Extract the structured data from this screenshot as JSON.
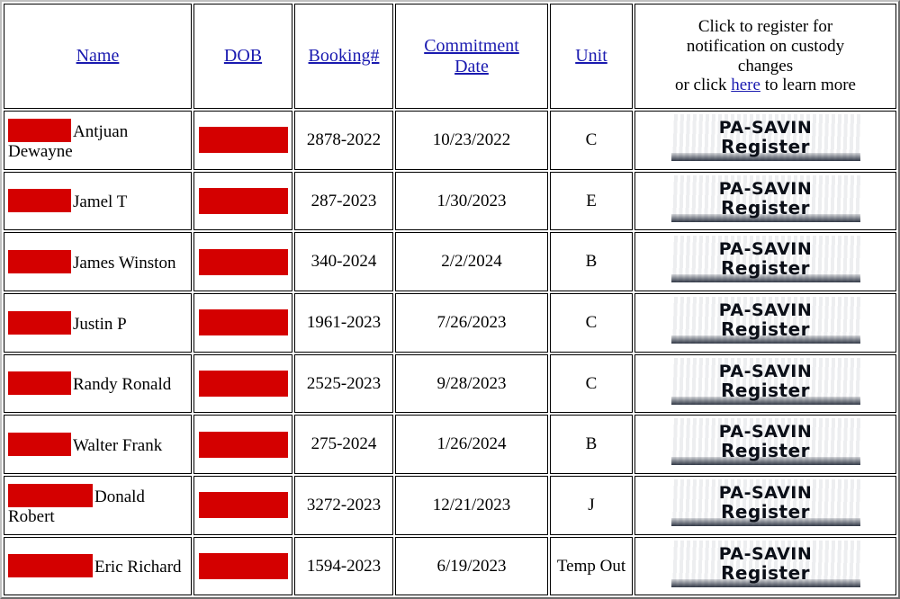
{
  "table": {
    "columns": [
      {
        "key": "name",
        "label": "Name",
        "link": true
      },
      {
        "key": "dob",
        "label": "DOB",
        "link": true
      },
      {
        "key": "book",
        "label": "Booking#",
        "link": true
      },
      {
        "key": "commit",
        "label": "Commitment Date",
        "link": true
      },
      {
        "key": "unit",
        "label": "Unit",
        "link": true
      },
      {
        "key": "savin",
        "label": "",
        "link": false
      }
    ],
    "header_links": {
      "name": "Name",
      "dob": "DOB",
      "booking": "Booking#",
      "commitment_line1": "Commitment",
      "commitment_line2": "Date",
      "unit": "Unit"
    },
    "savin_header": {
      "line1": "Click to register for",
      "line2": "notification on custody",
      "line3": "changes",
      "line4_prefix": "or click ",
      "line4_link": "here",
      "line4_suffix": " to learn more"
    },
    "savin_button": {
      "line1": "PA-SAVIN",
      "line2": "Register",
      "alt": "PA-SAVIN Register"
    },
    "redaction_color": "#d40000",
    "link_color": "#1a1ab0",
    "rows": [
      {
        "name_redacted": true,
        "name_redaction_width": "narrow",
        "name": "Antjuan Dewayne",
        "dob_redacted": true,
        "dob": "",
        "booking": "2878-2022",
        "commitment_date": "10/23/2022",
        "unit": "C"
      },
      {
        "name_redacted": true,
        "name_redaction_width": "narrow",
        "name": "Jamel T",
        "dob_redacted": true,
        "dob": "",
        "booking": "287-2023",
        "commitment_date": "1/30/2023",
        "unit": "E"
      },
      {
        "name_redacted": true,
        "name_redaction_width": "narrow",
        "name": "James Winston",
        "dob_redacted": true,
        "dob": "",
        "booking": "340-2024",
        "commitment_date": "2/2/2024",
        "unit": "B"
      },
      {
        "name_redacted": true,
        "name_redaction_width": "narrow",
        "name": "Justin P",
        "dob_redacted": true,
        "dob": "",
        "booking": "1961-2023",
        "commitment_date": "7/26/2023",
        "unit": "C"
      },
      {
        "name_redacted": true,
        "name_redaction_width": "narrow",
        "name": "Randy Ronald",
        "dob_redacted": true,
        "dob": "",
        "booking": "2525-2023",
        "commitment_date": "9/28/2023",
        "unit": "C"
      },
      {
        "name_redacted": true,
        "name_redaction_width": "narrow",
        "name": "Walter Frank",
        "dob_redacted": true,
        "dob": "",
        "booking": "275-2024",
        "commitment_date": "1/26/2024",
        "unit": "B"
      },
      {
        "name_redacted": true,
        "name_redaction_width": "wide",
        "name": "Donald Robert",
        "dob_redacted": true,
        "dob": "",
        "booking": "3272-2023",
        "commitment_date": "12/21/2023",
        "unit": "J"
      },
      {
        "name_redacted": true,
        "name_redaction_width": "wide",
        "name": "Eric Richard",
        "dob_redacted": true,
        "dob": "",
        "booking": "1594-2023",
        "commitment_date": "6/19/2023",
        "unit": "Temp Out"
      }
    ]
  }
}
